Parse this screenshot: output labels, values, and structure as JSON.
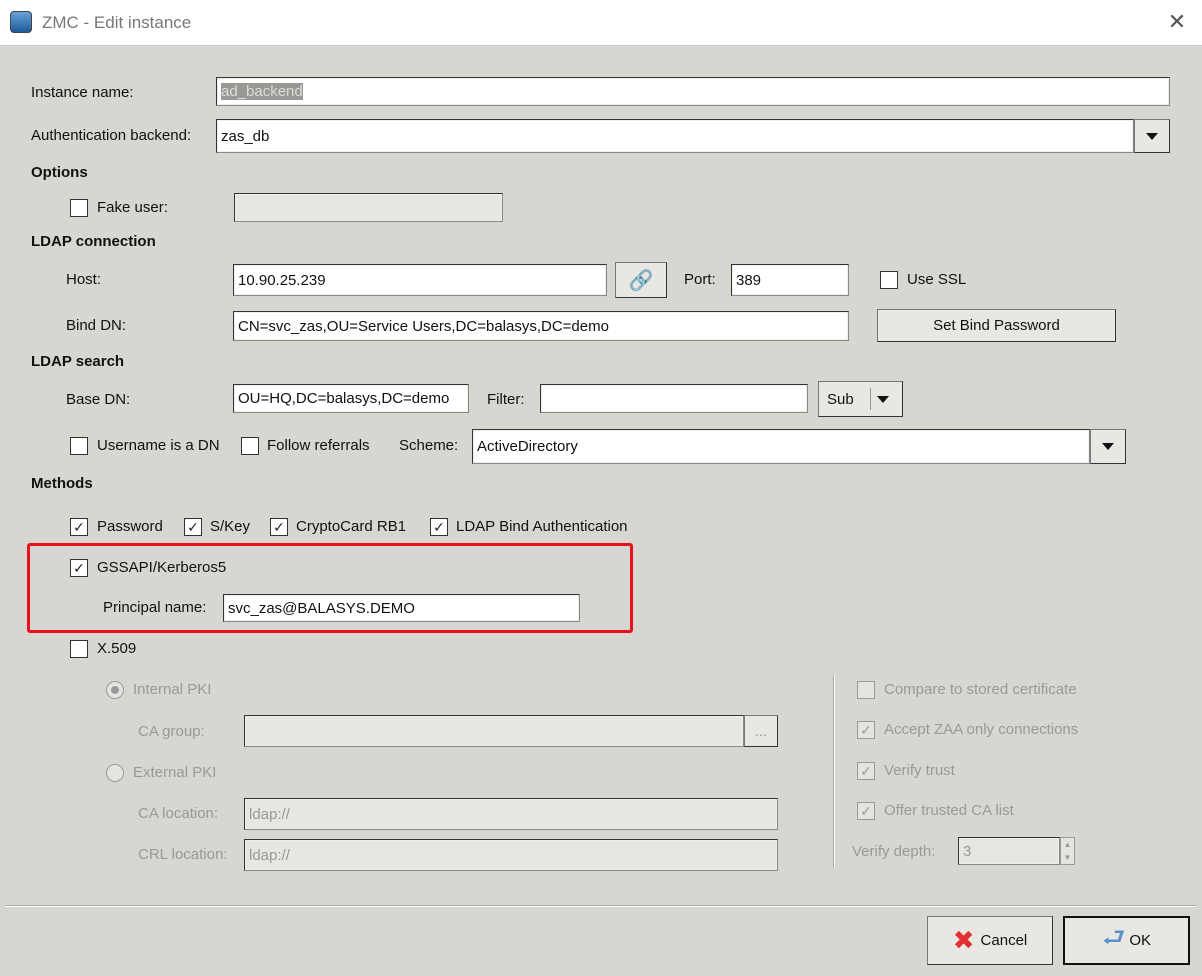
{
  "window": {
    "title": "ZMC - Edit instance",
    "close_icon": "close-icon"
  },
  "instance_name": {
    "label": "Instance name:",
    "value": "ad_backend"
  },
  "auth_backend": {
    "label": "Authentication backend:",
    "value": "zas_db"
  },
  "options": {
    "heading": "Options",
    "fake_user": {
      "label": "Fake user:",
      "checked": false,
      "value": ""
    }
  },
  "ldap_connection": {
    "heading": "LDAP connection",
    "host_label": "Host:",
    "host": "10.90.25.239",
    "port_label": "Port:",
    "port": "389",
    "use_ssl": {
      "label": "Use SSL",
      "checked": false
    },
    "bind_dn_label": "Bind DN:",
    "bind_dn": "CN=svc_zas,OU=Service Users,DC=balasys,DC=demo",
    "set_bind_password": "Set Bind Password"
  },
  "ldap_search": {
    "heading": "LDAP search",
    "base_dn_label": "Base DN:",
    "base_dn": "OU=HQ,DC=balasys,DC=demo",
    "filter_label": "Filter:",
    "filter": "",
    "scope": "Sub",
    "username_is_dn": {
      "label": "Username is a DN",
      "checked": false
    },
    "follow_referrals": {
      "label": "Follow referrals",
      "checked": false
    },
    "scheme_label": "Scheme:",
    "scheme": "ActiveDirectory"
  },
  "methods": {
    "heading": "Methods",
    "password": {
      "label": "Password",
      "checked": true
    },
    "skey": {
      "label": "S/Key",
      "checked": true
    },
    "cryptocard": {
      "label": "CryptoCard RB1",
      "checked": true
    },
    "ldap_bind": {
      "label": "LDAP Bind Authentication",
      "checked": true
    },
    "gssapi": {
      "label": "GSSAPI/Kerberos5",
      "checked": true,
      "principal_label": "Principal name:",
      "principal": "svc_zas@BALASYS.DEMO"
    },
    "x509": {
      "label": "X.509",
      "checked": false,
      "internal_pki": "Internal PKI",
      "ca_group_label": "CA group:",
      "ca_group": "",
      "browse": "...",
      "external_pki": "External PKI",
      "ca_location_label": "CA location:",
      "ca_location": "ldap://",
      "crl_location_label": "CRL location:",
      "crl_location": "ldap://",
      "compare_stored": {
        "label": "Compare to stored certificate",
        "checked": false
      },
      "accept_zaa": {
        "label": "Accept ZAA only connections",
        "checked": true
      },
      "verify_trust": {
        "label": "Verify trust",
        "checked": true
      },
      "offer_ca": {
        "label": "Offer trusted CA list",
        "checked": true
      },
      "verify_depth_label": "Verify depth:",
      "verify_depth": "3"
    }
  },
  "buttons": {
    "cancel": "Cancel",
    "ok": "OK"
  },
  "colors": {
    "highlight": "#e8101e",
    "background": "#d8d6d1"
  }
}
